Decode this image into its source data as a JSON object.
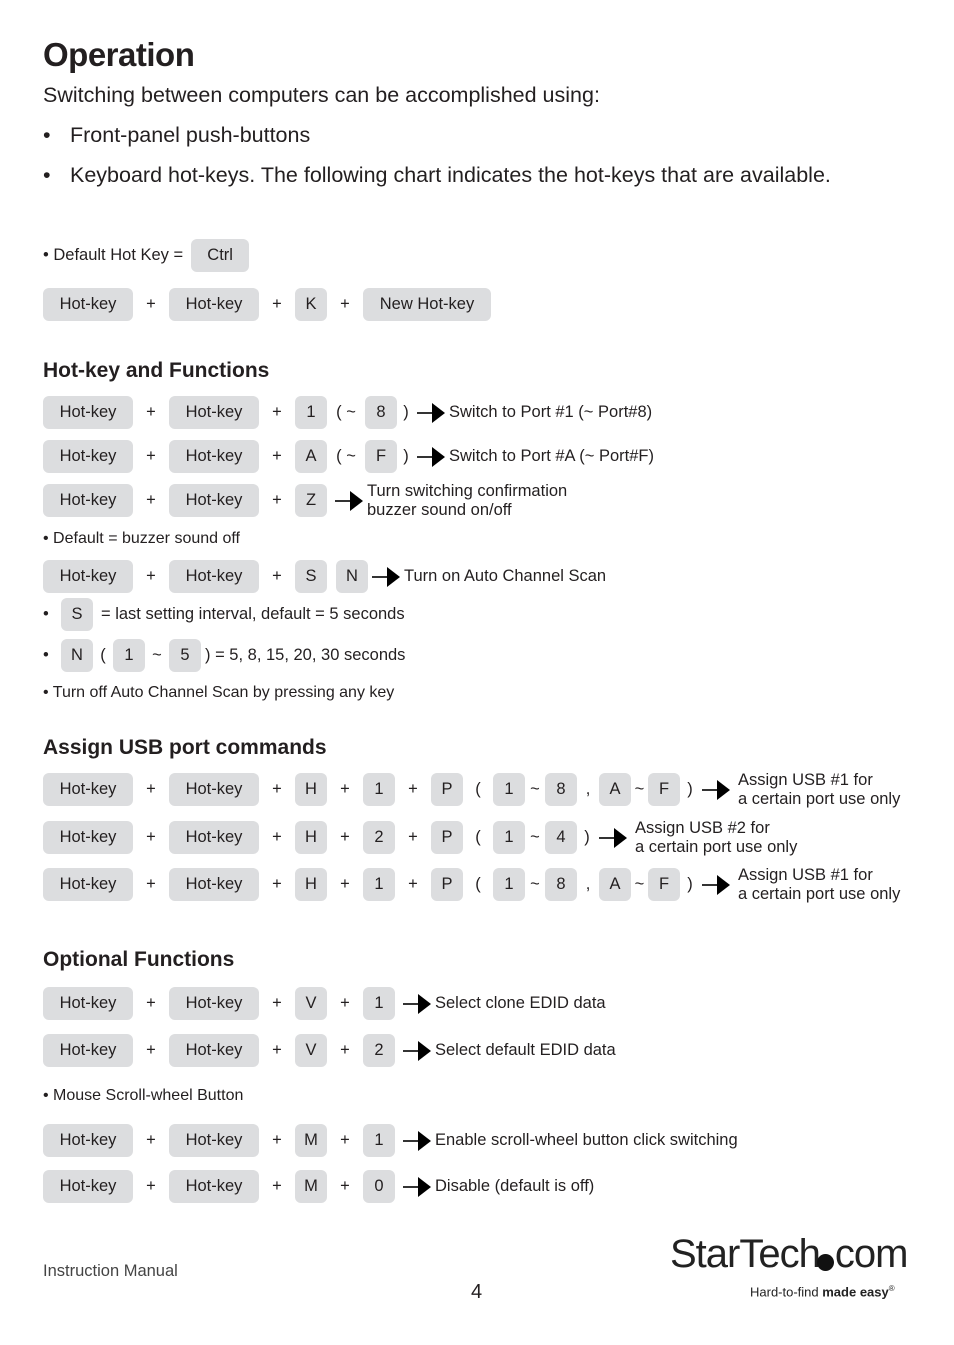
{
  "page": {
    "title": "Operation",
    "intro": "Switching between computers can be accomplished using:",
    "bullets": [
      "Front-panel push-buttons",
      "Keyboard hot-keys. The following chart indicates the hot-keys that are available."
    ]
  },
  "default_hotkey": {
    "label": "• Default Hot Key =",
    "key": "Ctrl"
  },
  "change_hotkey": {
    "keys": [
      "Hot-key",
      "Hot-key",
      "K",
      "New Hot-key"
    ],
    "plus": "+"
  },
  "sections": {
    "hotkey_functions": {
      "title": "Hot-key and Functions",
      "rows": [
        {
          "keys": [
            "Hot-key",
            "Hot-key",
            "1"
          ],
          "range_open": "( ~",
          "range_end": "8",
          "range_close": ")",
          "desc": "Switch to Port #1 (~ Port#8)"
        },
        {
          "keys": [
            "Hot-key",
            "Hot-key",
            "A"
          ],
          "range_open": "( ~",
          "range_end": "F",
          "range_close": ")",
          "desc": "Switch to Port #A (~ Port#F)"
        },
        {
          "keys": [
            "Hot-key",
            "Hot-key",
            "Z"
          ],
          "desc_line1": "Turn switching confirmation",
          "desc_line2": "buzzer sound on/off"
        }
      ],
      "note_buzzer": "• Default = buzzer sound off",
      "auto_scan": {
        "keys": [
          "Hot-key",
          "Hot-key",
          "S",
          "N"
        ],
        "desc": "Turn on Auto Channel Scan"
      },
      "note_s": {
        "key": "S",
        "text": "= last setting interval, default = 5 seconds"
      },
      "note_n": {
        "key": "N",
        "open": "(",
        "from": "1",
        "tilde": "~",
        "to": "5",
        "text": ") = 5, 8, 15, 20, 30 seconds"
      },
      "note_off": "• Turn off Auto Channel Scan by pressing any key"
    },
    "usb": {
      "title": "Assign USB port commands",
      "rows": [
        {
          "keys": [
            "Hot-key",
            "Hot-key",
            "H",
            "1",
            "P"
          ],
          "r1": [
            "1",
            "8"
          ],
          "r2": [
            "A",
            "F"
          ],
          "desc_line1": "Assign USB #1 for",
          "desc_line2": "a certain port use only"
        },
        {
          "keys": [
            "Hot-key",
            "Hot-key",
            "H",
            "2",
            "P"
          ],
          "r1": [
            "1",
            "4"
          ],
          "desc_line1": "Assign USB #2 for",
          "desc_line2": "a certain port use only"
        },
        {
          "keys": [
            "Hot-key",
            "Hot-key",
            "H",
            "1",
            "P"
          ],
          "r1": [
            "1",
            "8"
          ],
          "r2": [
            "A",
            "F"
          ],
          "desc_line1": "Assign USB #1 for",
          "desc_line2": "a certain port use only"
        }
      ]
    },
    "optional": {
      "title": "Optional Functions",
      "rows": [
        {
          "keys": [
            "Hot-key",
            "Hot-key",
            "V",
            "1"
          ],
          "desc": "Select clone EDID data"
        },
        {
          "keys": [
            "Hot-key",
            "Hot-key",
            "V",
            "2"
          ],
          "desc": "Select default EDID data"
        }
      ],
      "note_mouse": "• Mouse Scroll-wheel Button",
      "mouse_rows": [
        {
          "keys": [
            "Hot-key",
            "Hot-key",
            "M",
            "1"
          ],
          "desc": "Enable scroll-wheel button click switching"
        },
        {
          "keys": [
            "Hot-key",
            "Hot-key",
            "M",
            "0"
          ],
          "desc": "Disable (default is off)"
        }
      ]
    }
  },
  "symbols": {
    "plus": "+",
    "tilde": "~",
    "comma": ",",
    "open": "(",
    "close": ")",
    "bullet": "•"
  },
  "footer": {
    "left": "Instruction Manual",
    "page_number": "4",
    "logo_main": "StarTech",
    "logo_com": "com",
    "tagline_normal": "Hard-to-find ",
    "tagline_bold": "made easy",
    "tagline_reg": "®"
  },
  "colors": {
    "key_bg": "#dcdddf",
    "text": "#231f20"
  }
}
